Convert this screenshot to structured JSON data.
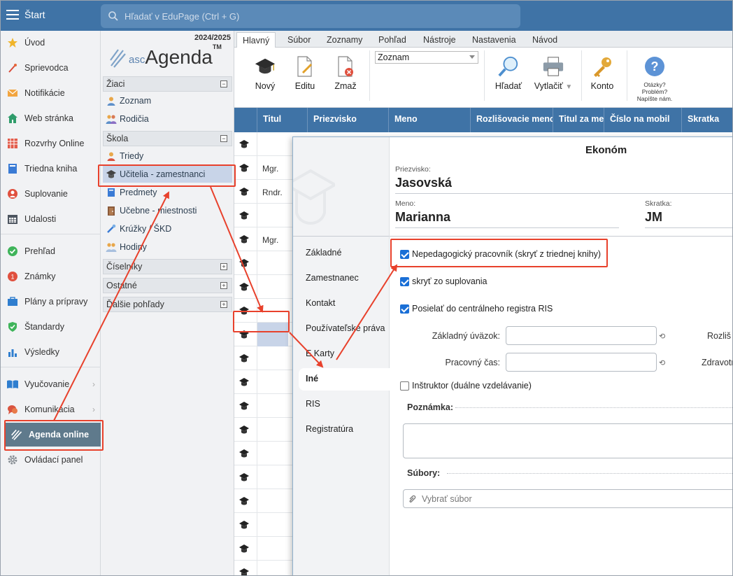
{
  "topbar": {
    "start_label": "Štart",
    "search_placeholder": "Hľadať v EduPage (Ctrl + G)"
  },
  "leftnav": {
    "items": [
      {
        "label": "Úvod",
        "icon": "star-icon"
      },
      {
        "label": "Sprievodca",
        "icon": "magic-wand-icon"
      },
      {
        "label": "Notifikácie",
        "icon": "envelope-icon"
      },
      {
        "label": "Web stránka",
        "icon": "home-icon"
      },
      {
        "label": "Rozvrhy Online",
        "icon": "timetable-icon"
      },
      {
        "label": "Triedna kniha",
        "icon": "book-icon"
      },
      {
        "label": "Suplovanie",
        "icon": "substitution-icon"
      },
      {
        "label": "Udalosti",
        "icon": "calendar-icon"
      },
      {
        "label": "Prehľad",
        "icon": "check-circle-icon"
      },
      {
        "label": "Známky",
        "icon": "grades-icon"
      },
      {
        "label": "Plány a prípravy",
        "icon": "briefcase-icon"
      },
      {
        "label": "Štandardy",
        "icon": "shield-icon"
      },
      {
        "label": "Výsledky",
        "icon": "bar-chart-icon"
      },
      {
        "label": "Vyučovanie",
        "icon": "open-book-icon"
      },
      {
        "label": "Komunikácia",
        "icon": "chat-icon"
      },
      {
        "label": "Agenda online",
        "icon": "agenda-icon"
      },
      {
        "label": "Ovládací panel",
        "icon": "gear-icon"
      }
    ]
  },
  "agenda": {
    "year": "2024/2025",
    "logo_asc": "asc",
    "logo_agenda": "Agenda",
    "logo_tm": "TM",
    "sections": {
      "ziaci": "Žiaci",
      "skola": "Škola",
      "ciselniky": "Číselníky",
      "ostatne": "Ostatné",
      "dalsie": "Ďalšie pohľady"
    },
    "items": {
      "zoznam": "Zoznam",
      "rodicia": "Rodičia",
      "triedy": "Triedy",
      "ucitelia": "Učitelia - zamestnanci",
      "predmety": "Predmety",
      "ucebne": "Učebne - miestnosti",
      "kruzky": "Krúžky / ŠKD",
      "hodiny": "Hodiny"
    }
  },
  "main": {
    "tabs": [
      "Hlavný",
      "Súbor",
      "Zoznamy",
      "Pohľad",
      "Nástroje",
      "Nastavenia",
      "Návod"
    ],
    "ribbon": {
      "novy": "Nový",
      "editu": "Editu",
      "zmaz": "Zmaž",
      "view_select": "Zoznam",
      "hladat": "Hľadať",
      "vytlacit": "Vytlačiť",
      "konto": "Konto",
      "help_line1": "Otázky?",
      "help_line2": "Problém?",
      "help_line3": "Napíšte nám."
    },
    "grid": {
      "columns": [
        "Titul",
        "Priezvisko",
        "Meno",
        "Rozlišovacie meno",
        "Titul za me",
        "Číslo na mobil",
        "Skratka"
      ],
      "rows": [
        "",
        "Mgr.",
        "Rndr.",
        "",
        "Mgr.",
        "",
        "",
        "",
        "",
        "",
        "",
        "",
        "",
        "",
        "",
        "",
        "",
        "",
        ""
      ]
    }
  },
  "dialog": {
    "title": "Ekonóm",
    "surname_label": "Priezvisko:",
    "surname": "Jasovská",
    "name_label": "Meno:",
    "name": "Marianna",
    "abbr_label": "Skratka:",
    "abbr": "JM",
    "tabs": [
      "Základné",
      "Zamestnanec",
      "Kontakt",
      "Používateľské práva",
      "E Karty",
      "Iné",
      "RIS",
      "Registratúra"
    ],
    "checks": {
      "nepedagogicky": "Nepedagogický pracovník (skryť z triednej knihy)",
      "suplovanie": "skryť zo suplovania",
      "ris": "Posielať do centrálneho registra RIS",
      "instruktor": "Inštruktor (duálne vzdelávanie)"
    },
    "fields": {
      "uvazok": "Základný úväzok:",
      "cas": "Pracovný čas:",
      "rozlis": "Rozliš",
      "zdravotn": "Zdravotn"
    },
    "poznamka": "Poznámka:",
    "subory": "Súbory:",
    "vybrat_subor": "Vybrať súbor"
  },
  "colors": {
    "topbar": "#3f73a6",
    "grid_header": "#3f73a6",
    "annotation": "#e8412c",
    "selection": "#c8d4e8",
    "checkbox": "#1a6fd6"
  }
}
